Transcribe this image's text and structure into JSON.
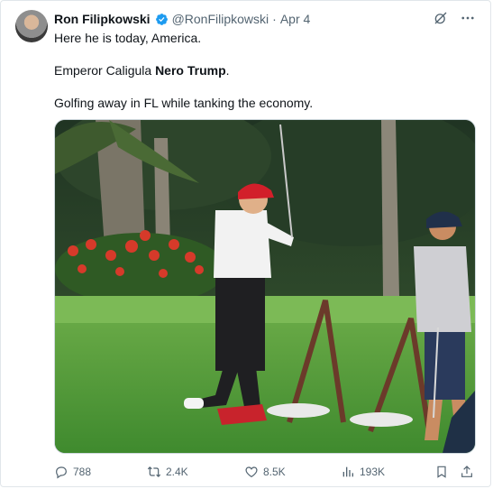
{
  "tweet": {
    "author_name": "Ron Filipkowski",
    "handle": "@RonFilipkowski",
    "separator": "·",
    "date": "Apr 4",
    "line1": "Here he is today, America.",
    "line2_prefix": "Emperor Caligula ",
    "line2_bold": "Nero Trump",
    "line2_suffix": ".",
    "line3": "Golfing away in FL while tanking the economy."
  },
  "metrics": {
    "replies": "788",
    "reposts": "2.4K",
    "likes": "8.5K",
    "views": "193K"
  },
  "icons": {
    "verified": "verified-badge-icon",
    "grok": "grok-icon",
    "more": "more-icon",
    "reply": "reply-icon",
    "repost": "repost-icon",
    "like": "heart-icon",
    "views": "views-icon",
    "bookmark": "bookmark-icon",
    "share": "share-icon"
  },
  "colors": {
    "verified": "#1d9bf0",
    "secondary_text": "#536471",
    "primary_text": "#0f1419"
  }
}
